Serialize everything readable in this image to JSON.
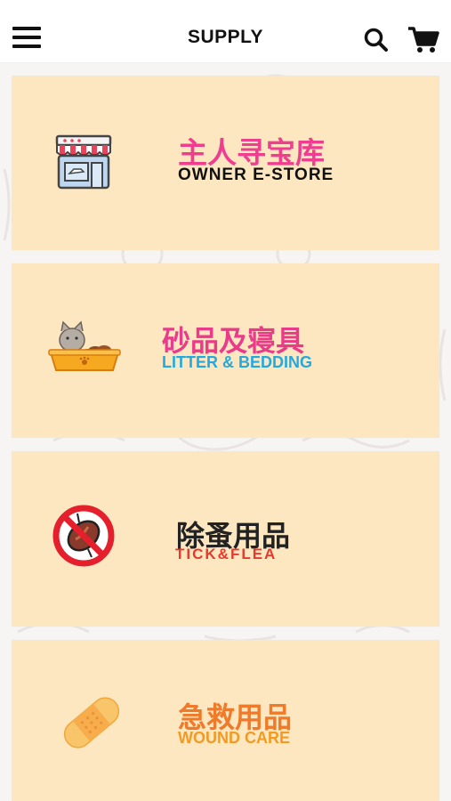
{
  "header": {
    "title": "SUPPLY"
  },
  "categories": [
    {
      "cn": "主人寻宝库",
      "en": "OWNER E-STORE",
      "cn_color": "#ef3e8f",
      "en_color": "#111111",
      "icon": "storefront-icon"
    },
    {
      "cn": "砂品及寝具",
      "en": "LITTER & BEDDING",
      "cn_color": "#ea3a8a",
      "en_color": "#22a9e0",
      "icon": "litter-box-cat-icon"
    },
    {
      "cn": "除蚤用品",
      "en": "TICK&FLEA",
      "cn_color": "#222222",
      "en_color": "#e8392e",
      "icon": "no-flea-icon"
    },
    {
      "cn": "急救用品",
      "en": "WOUND CARE",
      "cn_color": "#ef7a2a",
      "en_color": "#f29a22",
      "icon": "bandage-icon"
    }
  ],
  "colors": {
    "card_bg": "#fde7c1",
    "page_bg": "#f6f5f4"
  }
}
